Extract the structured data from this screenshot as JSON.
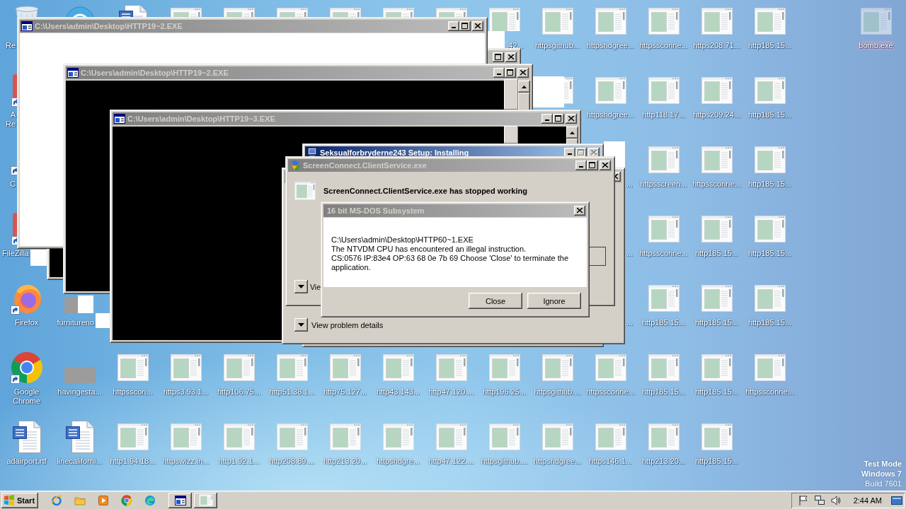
{
  "desktop": {
    "rows": [
      [
        {
          "kind": "bin",
          "label": "Re",
          "selected": false
        },
        {
          "kind": "round",
          "selected": false
        },
        {
          "kind": "doc",
          "selected": false
        },
        {
          "kind": "exe",
          "selected": false
        },
        {
          "kind": "exe",
          "selected": false
        },
        {
          "kind": "exe",
          "selected": false
        },
        {
          "kind": "exe",
          "selected": false
        },
        {
          "kind": "exe",
          "selected": false
        },
        {
          "kind": "exe",
          "selected": false
        },
        {
          "kind": "exe",
          "label": ".42...",
          "selected": false
        },
        {
          "kind": "exe",
          "label": "httpsgithub...",
          "selected": false
        },
        {
          "kind": "exe",
          "label": "httpshdgree...",
          "selected": false
        },
        {
          "kind": "exe",
          "label": "httpssconne...",
          "selected": false
        },
        {
          "kind": "exe",
          "label": "https208.71...",
          "selected": false
        },
        {
          "kind": "exe",
          "label": "http185.15...",
          "selected": false
        },
        null,
        {
          "kind": "exe",
          "label": "bomb.exe",
          "selected": true
        }
      ],
      [
        {
          "kind": "app",
          "label": "A\nRe",
          "selected": false
        },
        null,
        null,
        null,
        null,
        null,
        null,
        null,
        null,
        null,
        {
          "kind": "exe",
          "selected": false
        },
        {
          "kind": "exe",
          "label": "httpshdgree...",
          "selected": false
        },
        {
          "kind": "exe",
          "label": "http118.17...",
          "selected": false
        },
        {
          "kind": "exe",
          "label": "https209.24...",
          "selected": false
        },
        {
          "kind": "exe",
          "label": "http185.15...",
          "selected": false
        }
      ],
      [
        {
          "kind": "shortcut",
          "label": "C",
          "selected": false
        },
        null,
        null,
        null,
        null,
        null,
        null,
        null,
        null,
        null,
        null,
        {
          "label": "...",
          "selected": false
        },
        {
          "kind": "exe",
          "label": "httpsscreen...",
          "selected": false
        },
        {
          "kind": "exe",
          "label": "httpssconne...",
          "selected": false
        },
        {
          "kind": "exe",
          "label": "http185.15...",
          "selected": false
        }
      ],
      [
        {
          "kind": "app",
          "label": "FileZilla",
          "selected": false
        },
        null,
        null,
        null,
        null,
        null,
        null,
        null,
        null,
        null,
        null,
        {
          "label": "...",
          "selected": false
        },
        {
          "kind": "exe",
          "label": "httpssconne...",
          "selected": false
        },
        {
          "kind": "exe",
          "label": "http185.15...",
          "selected": false
        },
        {
          "kind": "exe",
          "label": "http185.15...",
          "selected": false
        }
      ],
      [
        {
          "kind": "firefox",
          "label": "Firefox",
          "selected": false
        },
        {
          "kind": "thumb",
          "label": "furnitureno",
          "selected": false
        },
        null,
        null,
        null,
        null,
        null,
        null,
        null,
        null,
        null,
        {
          "label": "...",
          "selected": false
        },
        {
          "kind": "exe",
          "label": "http185.15...",
          "selected": false
        },
        {
          "kind": "exe",
          "label": "http185.15...",
          "selected": false
        },
        {
          "kind": "exe",
          "label": "http185.15...",
          "selected": false
        }
      ],
      [
        {
          "kind": "chrome",
          "label": "Google Chrome",
          "selected": false
        },
        {
          "kind": "thumb",
          "label": "havingesta...",
          "selected": false
        },
        {
          "kind": "exe",
          "label": "httpsscon...",
          "selected": false
        },
        {
          "kind": "exe",
          "label": "https3.93.1...",
          "selected": false
        },
        {
          "kind": "exe",
          "label": "http106.75...",
          "selected": false
        },
        {
          "kind": "exe",
          "label": "http51.38.1...",
          "selected": false
        },
        {
          "kind": "exe",
          "label": "http75.127...",
          "selected": false
        },
        {
          "kind": "exe",
          "label": "http43.143...",
          "selected": false
        },
        {
          "kind": "exe",
          "label": "http47.120....",
          "selected": false
        },
        {
          "kind": "exe",
          "label": "http196.25...",
          "selected": false
        },
        {
          "kind": "exe",
          "label": "httpsgithub....",
          "selected": false
        },
        {
          "kind": "exe",
          "label": "httpssconne...",
          "selected": false
        },
        {
          "kind": "exe",
          "label": "http185.15...",
          "selected": false
        },
        {
          "kind": "exe",
          "label": "http185.15...",
          "selected": false
        },
        {
          "kind": "exe",
          "label": "httpssconne...",
          "selected": false
        }
      ],
      [
        {
          "kind": "doc",
          "label": "adairport.rtf",
          "selected": false
        },
        {
          "kind": "doc",
          "label": "linecaliforni...",
          "selected": false
        },
        {
          "kind": "exe",
          "label": "http1.94.18...",
          "selected": false
        },
        {
          "kind": "exe",
          "label": "httpswizz.in...",
          "selected": false
        },
        {
          "kind": "exe",
          "label": "http1.92.1...",
          "selected": false
        },
        {
          "kind": "exe",
          "label": "http208.89....",
          "selected": false
        },
        {
          "kind": "exe",
          "label": "http213.20...",
          "selected": false
        },
        {
          "kind": "exe",
          "label": "httpshdgre...",
          "selected": false
        },
        {
          "kind": "exe",
          "label": "http47.122....",
          "selected": false
        },
        {
          "kind": "exe",
          "label": "httpsgithub....",
          "selected": false
        },
        {
          "kind": "exe",
          "label": "httpshdgree...",
          "selected": false
        },
        {
          "kind": "exe",
          "label": "https146.1...",
          "selected": false
        },
        {
          "kind": "exe",
          "label": "http213.20...",
          "selected": false
        },
        {
          "kind": "exe",
          "label": "http185.15...",
          "selected": false
        }
      ]
    ],
    "system_notice": [
      {
        "text": "Test Mode",
        "kind": "mode"
      },
      {
        "text": "Windows 7",
        "kind": "edition"
      },
      {
        "text": "Build 7601",
        "kind": "build"
      }
    ]
  },
  "windows": [
    {
      "kind": "console",
      "active": false,
      "caption_buttons": [
        {
          "kind": "maximize",
          "disabled": false
        },
        {
          "kind": "close",
          "disabled": false
        }
      ]
    },
    {
      "kind": "blank",
      "title": "C:\\Users\\admin\\Desktop\\HTTP19~2.EXE",
      "active": false,
      "caption_buttons": [
        {
          "kind": "minimize",
          "disabled": false
        },
        {
          "kind": "maximize",
          "disabled": false
        },
        {
          "kind": "close",
          "disabled": false
        }
      ]
    },
    {
      "kind": "console",
      "title": "C:\\Users\\admin\\Desktop\\HTTP19~2.EXE",
      "active": false,
      "caption_buttons": [
        {
          "kind": "minimize",
          "disabled": false
        },
        {
          "kind": "maximize",
          "disabled": false
        },
        {
          "kind": "close",
          "disabled": false
        }
      ]
    },
    {
      "kind": "console",
      "title": "C:\\Users\\admin\\Desktop\\HTTP19~3.EXE",
      "active": false,
      "caption_buttons": [
        {
          "kind": "minimize",
          "disabled": false
        },
        {
          "kind": "maximize",
          "disabled": false
        },
        {
          "kind": "close",
          "disabled": false
        }
      ]
    },
    {
      "kind": "setup",
      "title": "Seksualforbryderne243 Setup: Installing",
      "active": true,
      "caption_buttons": [
        {
          "kind": "minimize",
          "disabled": false
        },
        {
          "kind": "maximize",
          "disabled": true
        },
        {
          "kind": "close",
          "disabled": true
        }
      ]
    },
    {
      "kind": "error_report",
      "title": "ScreenConnect.ClientService.exe",
      "active": false,
      "caption_buttons": [
        {
          "kind": "minimize",
          "disabled": false
        },
        {
          "kind": "maximize",
          "disabled": false
        },
        {
          "kind": "close",
          "disabled": false
        }
      ],
      "heading": "ScreenConnect.ClientService.exe has stopped working",
      "details_label": "Vie"
    },
    {
      "kind": "message",
      "title": "16 bit MS-DOS Subsystem",
      "active": false,
      "caption_buttons": [
        {
          "kind": "close",
          "disabled": false
        }
      ],
      "message_lines": [
        "C:\\Users\\admin\\Desktop\\HTTP60~1.EXE",
        "The NTVDM CPU has encountered an illegal instruction.",
        "CS:0576 IP:83e4 OP:63 68 0e 7b 69 Choose 'Close' to terminate the application."
      ],
      "buttons": [
        "Close",
        "Ignore"
      ]
    },
    {
      "kind": "error_report",
      "active": false,
      "caption_buttons": [
        {
          "kind": "close",
          "disabled": false
        }
      ],
      "details_label": "View problem details"
    }
  ],
  "taskbar": {
    "start_label": "Start",
    "clock": "2:44 AM"
  }
}
